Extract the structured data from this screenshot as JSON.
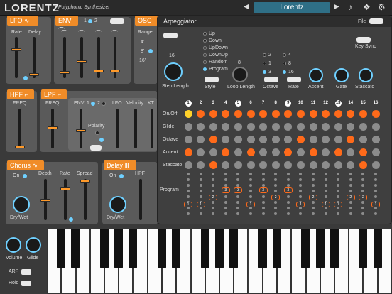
{
  "app": {
    "name": "LORENTZ",
    "subtitle": "Polyphonic Synthesizer",
    "preset": "Lorentz",
    "prev_icon": "triangle-left-icon",
    "next_icon": "triangle-right-icon"
  },
  "lfo": {
    "title": "LFO",
    "rate": "Rate",
    "delay": "Delay"
  },
  "env": {
    "title": "ENV",
    "sel1": "1",
    "sel2": "2"
  },
  "osc": {
    "title": "OSC",
    "range": "Range",
    "r1": "4'",
    "r2": "8'",
    "r3": "16'"
  },
  "hpf": {
    "title": "HPF",
    "freq": "FREQ"
  },
  "lpf": {
    "title": "LPF",
    "freq": "FREQ",
    "env": "ENV",
    "env1": "1",
    "env2": "2",
    "lfo": "LFO",
    "velocity": "Velocity",
    "kt": "KT",
    "polarity": "Polarity"
  },
  "chorus": {
    "title": "Chorus",
    "on": "On",
    "depth": "Depth",
    "rate": "Rate",
    "spread": "Spread",
    "drywet": "Dry/Wet"
  },
  "delay": {
    "title": "Delay",
    "on": "On",
    "hpf": "HPF",
    "drywet": "Dry/Wet"
  },
  "master": {
    "volume": "Volume",
    "glide": "Glide",
    "arp": "ARP",
    "hold": "Hold"
  },
  "arp": {
    "title": "Arpeggiator",
    "file": "File",
    "keysync": "Key Sync",
    "steplength_value": "16",
    "steplength": "Step Length",
    "style": "Style",
    "styles": [
      "Up",
      "Down",
      "UpDown",
      "DownUp",
      "Random",
      "Program"
    ],
    "style_selected": "Program",
    "looplength_value": "8",
    "looplength": "Loop Length",
    "octave": "Octave",
    "octaves": [
      "2",
      "1",
      "3"
    ],
    "octave_selected": "3",
    "rate": "Rate",
    "rates": [
      "4",
      "8",
      "16"
    ],
    "rate_selected": "16",
    "accent": "Accent",
    "gate": "Gate",
    "staccato": "Staccato",
    "steps": [
      "1",
      "2",
      "3",
      "4",
      "5",
      "6",
      "7",
      "8",
      "9",
      "10",
      "11",
      "12",
      "13",
      "14",
      "15",
      "16"
    ],
    "rows": [
      "On/Off",
      "Glide",
      "Octave",
      "Accent",
      "Staccato",
      "Program"
    ],
    "grid": {
      "onoff": [
        2,
        1,
        1,
        1,
        1,
        1,
        1,
        1,
        1,
        1,
        1,
        1,
        1,
        1,
        1,
        1
      ],
      "glide": [
        0,
        0,
        0,
        0,
        0,
        0,
        0,
        0,
        0,
        0,
        0,
        0,
        0,
        0,
        0,
        0
      ],
      "octave": [
        0,
        0,
        1,
        0,
        0,
        0,
        0,
        0,
        0,
        1,
        0,
        0,
        0,
        1,
        0,
        0
      ],
      "accent": [
        1,
        0,
        0,
        1,
        0,
        1,
        0,
        0,
        1,
        0,
        1,
        0,
        1,
        0,
        1,
        0
      ],
      "staccato": [
        0,
        0,
        1,
        0,
        0,
        0,
        0,
        0,
        0,
        0,
        0,
        0,
        0,
        0,
        1,
        0
      ]
    },
    "program": [
      "1",
      "1",
      "2",
      "3",
      "3",
      "1",
      "3",
      "2",
      "3",
      "1",
      "2",
      "1",
      "1",
      "2",
      "2",
      "1"
    ]
  }
}
